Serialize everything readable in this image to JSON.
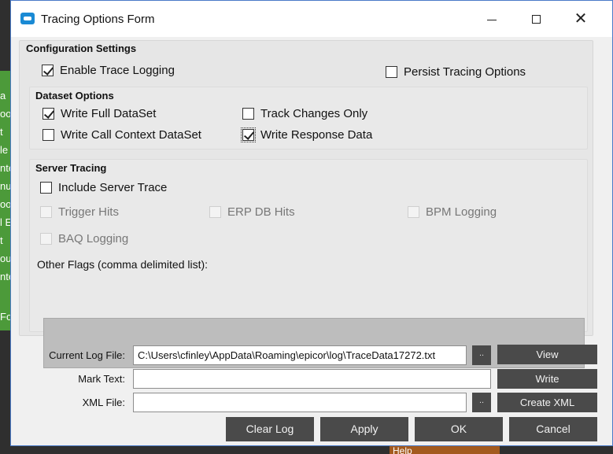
{
  "window": {
    "title": "Tracing Options Form"
  },
  "background": {
    "green_fragments": [
      "a",
      "oo",
      "t",
      "le",
      "nte",
      "nu",
      "oo",
      "l E",
      "t",
      "ou",
      "nte"
    ],
    "bottom_fragment": "Fo",
    "help_fragment": "Help"
  },
  "config": {
    "title": "Configuration Settings",
    "enable_trace_logging": {
      "label": "Enable Trace Logging",
      "checked": true
    },
    "persist_tracing_options": {
      "label": "Persist Tracing Options",
      "checked": false
    }
  },
  "dataset": {
    "title": "Dataset Options",
    "write_full_dataset": {
      "label": "Write Full DataSet",
      "checked": true
    },
    "track_changes_only": {
      "label": "Track Changes Only",
      "checked": false
    },
    "write_call_context": {
      "label": "Write Call Context DataSet",
      "checked": false
    },
    "write_response_data": {
      "label": "Write Response Data",
      "checked": true
    }
  },
  "server": {
    "title": "Server Tracing",
    "include_server_trace": {
      "label": "Include Server Trace",
      "checked": false
    },
    "trigger_hits": {
      "label": "Trigger Hits",
      "checked": false
    },
    "erp_db_hits": {
      "label": "ERP DB Hits",
      "checked": false
    },
    "bpm_logging": {
      "label": "BPM Logging",
      "checked": false
    },
    "baq_logging": {
      "label": "BAQ Logging",
      "checked": false
    },
    "other_flags_label": "Other Flags (comma delimited list):",
    "other_flags_value": ""
  },
  "files": {
    "current_log_label": "Current Log File:",
    "current_log_value": "C:\\Users\\cfinley\\AppData\\Roaming\\epicor\\log\\TraceData17272.txt",
    "mark_text_label": "Mark Text:",
    "mark_text_value": "",
    "xml_file_label": "XML File:",
    "xml_file_value": "",
    "browse_label": ".."
  },
  "buttons": {
    "view": "View",
    "write": "Write",
    "create_xml": "Create XML",
    "clear_log": "Clear Log",
    "apply": "Apply",
    "ok": "OK",
    "cancel": "Cancel"
  }
}
